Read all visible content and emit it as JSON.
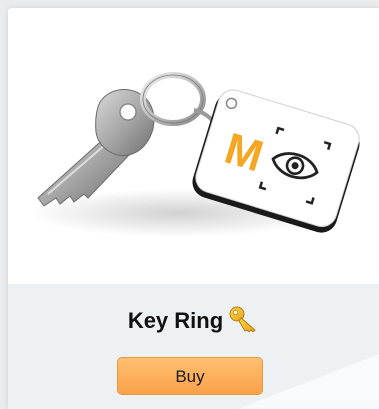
{
  "product": {
    "title": "Key Ring",
    "title_icon": "key-emoji-icon",
    "image_icon": "key-ring-photo",
    "logo_letter": "M",
    "buy_label": "Buy"
  },
  "colors": {
    "button_top": "#ffbf72",
    "button_bottom": "#f9a24a",
    "logo_orange": "#f5a623",
    "footer_bg": "#eef1f4"
  }
}
